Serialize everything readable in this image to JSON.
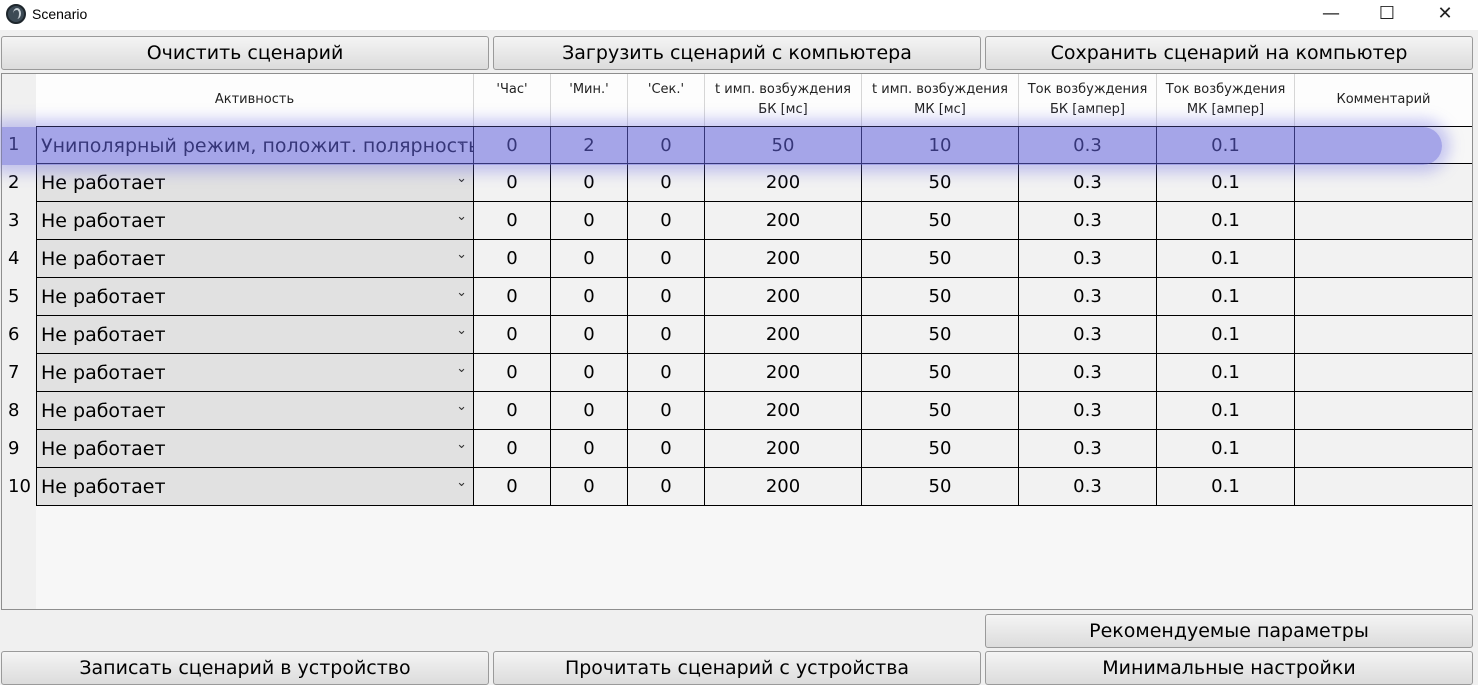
{
  "window": {
    "title": "Scenario",
    "controls": {
      "minimize": "—",
      "maximize": "☐",
      "close": "✕"
    }
  },
  "toolbar": {
    "clear_label": "Очистить сценарий",
    "load_label": "Загрузить сценарий с компьютера",
    "save_label": "Сохранить сценарий на компьютер"
  },
  "table": {
    "headers": {
      "activity": "Активность",
      "hour": "'Час'",
      "min": "'Мин.'",
      "sec": "'Сек.'",
      "t_bk": "t имп. возбуждения\nБК [мс]",
      "t_mk": "t имп. возбуждения\nМК [мс]",
      "i_bk": "Ток возбуждения\nБК [ампер]",
      "i_mk": "Ток возбуждения\nМК [ампер]",
      "comment": "Комментарий"
    },
    "rows": [
      {
        "num": "1",
        "activity": "Униполярный режим, положит. полярность",
        "hour": "0",
        "min": "2",
        "sec": "0",
        "t_bk": "50",
        "t_mk": "10",
        "i_bk": "0.3",
        "i_mk": "0.1",
        "comment": ""
      },
      {
        "num": "2",
        "activity": "Не работает",
        "hour": "0",
        "min": "0",
        "sec": "0",
        "t_bk": "200",
        "t_mk": "50",
        "i_bk": "0.3",
        "i_mk": "0.1",
        "comment": ""
      },
      {
        "num": "3",
        "activity": "Не работает",
        "hour": "0",
        "min": "0",
        "sec": "0",
        "t_bk": "200",
        "t_mk": "50",
        "i_bk": "0.3",
        "i_mk": "0.1",
        "comment": ""
      },
      {
        "num": "4",
        "activity": "Не работает",
        "hour": "0",
        "min": "0",
        "sec": "0",
        "t_bk": "200",
        "t_mk": "50",
        "i_bk": "0.3",
        "i_mk": "0.1",
        "comment": ""
      },
      {
        "num": "5",
        "activity": "Не работает",
        "hour": "0",
        "min": "0",
        "sec": "0",
        "t_bk": "200",
        "t_mk": "50",
        "i_bk": "0.3",
        "i_mk": "0.1",
        "comment": ""
      },
      {
        "num": "6",
        "activity": "Не работает",
        "hour": "0",
        "min": "0",
        "sec": "0",
        "t_bk": "200",
        "t_mk": "50",
        "i_bk": "0.3",
        "i_mk": "0.1",
        "comment": ""
      },
      {
        "num": "7",
        "activity": "Не работает",
        "hour": "0",
        "min": "0",
        "sec": "0",
        "t_bk": "200",
        "t_mk": "50",
        "i_bk": "0.3",
        "i_mk": "0.1",
        "comment": ""
      },
      {
        "num": "8",
        "activity": "Не работает",
        "hour": "0",
        "min": "0",
        "sec": "0",
        "t_bk": "200",
        "t_mk": "50",
        "i_bk": "0.3",
        "i_mk": "0.1",
        "comment": ""
      },
      {
        "num": "9",
        "activity": "Не работает",
        "hour": "0",
        "min": "0",
        "sec": "0",
        "t_bk": "200",
        "t_mk": "50",
        "i_bk": "0.3",
        "i_mk": "0.1",
        "comment": ""
      },
      {
        "num": "10",
        "activity": "Не работает",
        "hour": "0",
        "min": "0",
        "sec": "0",
        "t_bk": "200",
        "t_mk": "50",
        "i_bk": "0.3",
        "i_mk": "0.1",
        "comment": ""
      }
    ],
    "dropdown_icon": "chevron-down-icon",
    "selected_row_color": "#6363dc"
  },
  "bottom": {
    "recommended_label": "Рекомендуемые параметры",
    "write_label": "Записать сценарий в устройство",
    "read_label": "Прочитать сценарий с устройства",
    "minimal_label": "Минимальные настройки"
  }
}
